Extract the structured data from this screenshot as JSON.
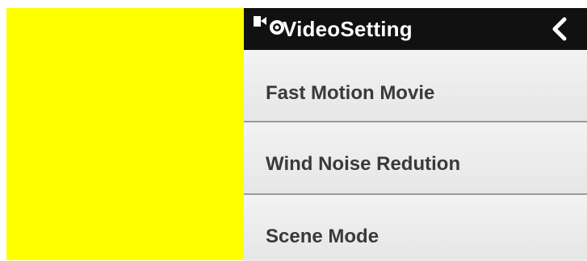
{
  "header": {
    "title": "VideoSetting",
    "icon": "video-settings-icon",
    "back_icon": "chevron-left-icon"
  },
  "menu": {
    "items": [
      {
        "label": "Fast Motion Movie"
      },
      {
        "label": "Wind Noise Redution"
      },
      {
        "label": "Scene Mode"
      }
    ]
  },
  "colors": {
    "left_panel": "#ffff00",
    "header_bg": "#111111",
    "header_text": "#ffffff",
    "menu_bg": "#ececec",
    "menu_text": "#3a3a3a",
    "divider": "#9a9a9a"
  }
}
